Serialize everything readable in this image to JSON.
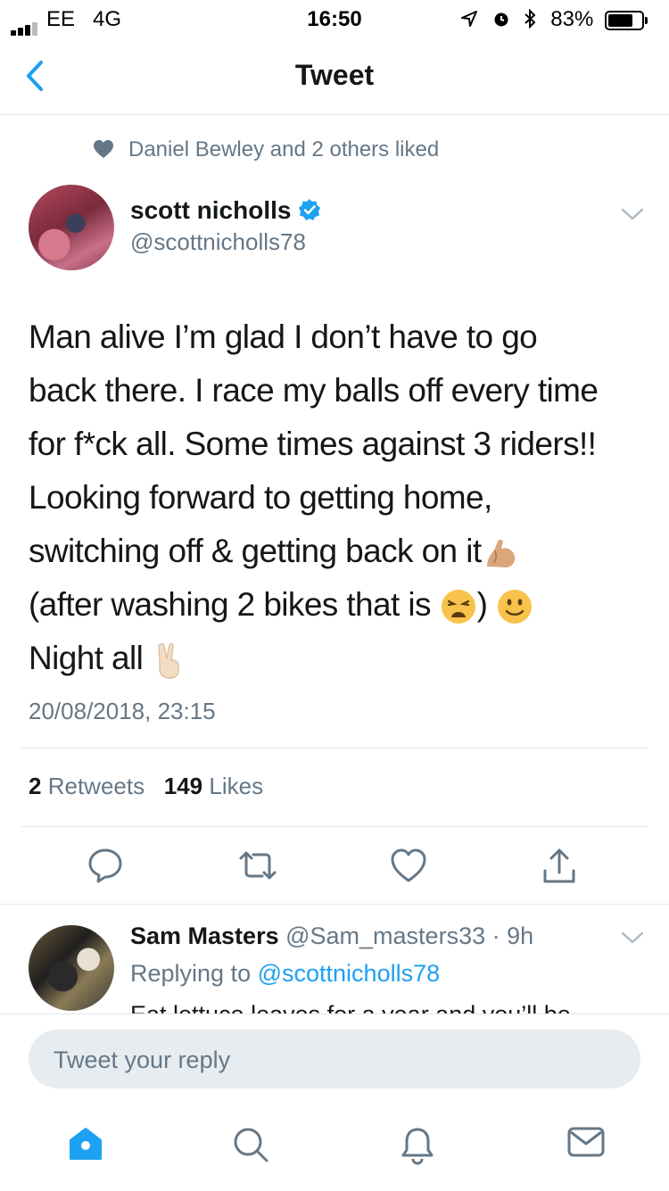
{
  "status_bar": {
    "carrier": "EE",
    "network": "4G",
    "time": "16:50",
    "battery": "83%",
    "battery_level": 0.83
  },
  "nav": {
    "title": "Tweet",
    "back_icon": "chevron-left-icon"
  },
  "social_context": {
    "text": "Daniel Bewley and 2 others liked",
    "icon": "heart-icon"
  },
  "tweet": {
    "author_name": "scott nicholls",
    "author_handle": "@scottnicholls78",
    "verified": true,
    "lines": [
      "Man alive I’m glad I don’t have to go",
      "back there. I race my balls off every time",
      "for f*ck all. Some times against 3 riders!!",
      "Looking forward to getting home,",
      "switching off & getting back on it",
      "(after washing 2 bikes that is",
      ")",
      "Night all"
    ],
    "emojis": [
      "flexed-biceps",
      "weary-face",
      "slightly-smiling-face",
      "victory-hand"
    ],
    "timestamp": "20/08/2018, 23:15",
    "retweets_count": "2",
    "retweets_label": "Retweets",
    "likes_count": "149",
    "likes_label": "Likes"
  },
  "actions": [
    "reply-icon",
    "retweet-icon",
    "like-icon",
    "share-icon"
  ],
  "reply": {
    "author_name": "Sam Masters",
    "author_handle": "@Sam_masters33",
    "separator": "·",
    "age": "9h",
    "replying_prefix": "Replying to",
    "replying_to": "@scottnicholls78",
    "text": "Eat lettuce leaves for a year and you’ll be"
  },
  "composer": {
    "placeholder": "Tweet your reply"
  },
  "tab_bar": [
    "home-icon",
    "search-icon",
    "notifications-icon",
    "messages-icon"
  ],
  "colors": {
    "accent": "#1da1f2",
    "text": "#14171a",
    "secondary": "#657786",
    "divider": "#e1e8ed"
  }
}
